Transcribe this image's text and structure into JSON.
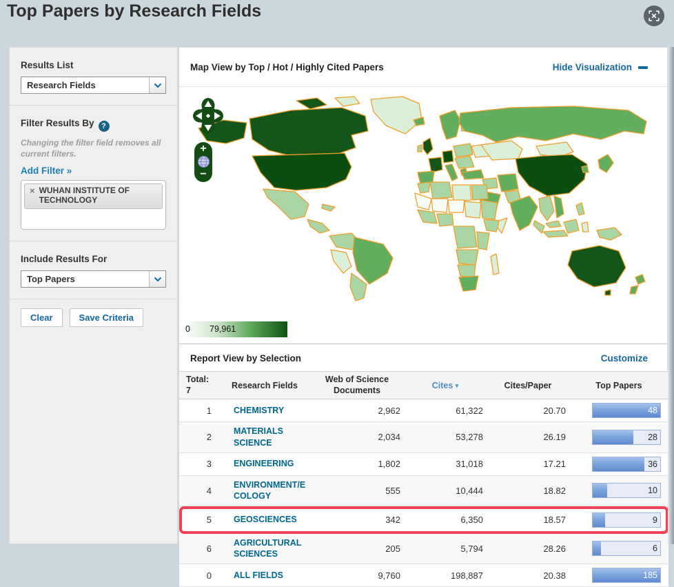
{
  "page": {
    "title": "Top Papers by Research Fields"
  },
  "colors": {
    "page_bg": "#ccd6dd",
    "link_blue": "#15679d",
    "field_link_blue": "#00688f",
    "sorted_column_blue": "#4d8fc0",
    "highlight_red": "#ee4257",
    "bar_fill_blue": "#7ea4de",
    "map_border_orange": "#efa02c",
    "map_dark_green": "#14551a",
    "control_green": "#134d13"
  },
  "sidebar": {
    "results_list_label": "Results List",
    "results_list_value": "Research Fields",
    "filter_label": "Filter Results By",
    "filter_help": "?",
    "filter_note": "Changing the filter field removes all current filters.",
    "add_filter": "Add Filter »",
    "tag_close": "×",
    "tag_label": "WUHAN INSTITUTE OF TECHNOLOGY",
    "include_label": "Include Results For",
    "include_value": "Top Papers",
    "clear_button": "Clear",
    "save_button": "Save Criteria"
  },
  "map_view": {
    "title": "Map View by Top / Hot / Highly Cited Papers",
    "hide_link": "Hide Visualization",
    "legend_min": "0",
    "legend_max": "79,961",
    "zoom_in": "+",
    "zoom_out": "−"
  },
  "report": {
    "title": "Report View by Selection",
    "customize_link": "Customize",
    "col_total": "Total:\n7",
    "col_field": "Research Fields",
    "col_docs": "Web of Science\nDocuments",
    "col_cites": "Cites",
    "sort_icon": "▾",
    "col_cpp": "Cites/Paper",
    "col_top": "Top Papers",
    "rows": [
      {
        "rank": "1",
        "field": "CHEMISTRY",
        "docs": "2,962",
        "cites": "61,322",
        "cpp": "20.70",
        "top_papers": "48",
        "bar_pct": 100,
        "bar_full": true,
        "highlight": false,
        "shaded": false
      },
      {
        "rank": "2",
        "field": "MATERIALS\nSCIENCE",
        "docs": "2,034",
        "cites": "53,278",
        "cpp": "26.19",
        "top_papers": "28",
        "bar_pct": 60,
        "bar_full": false,
        "highlight": false,
        "shaded": true
      },
      {
        "rank": "3",
        "field": "ENGINEERING",
        "docs": "1,802",
        "cites": "31,018",
        "cpp": "17.21",
        "top_papers": "36",
        "bar_pct": 77,
        "bar_full": false,
        "highlight": false,
        "shaded": false
      },
      {
        "rank": "4",
        "field": "ENVIRONMENT/E\nCOLOGY",
        "docs": "555",
        "cites": "10,444",
        "cpp": "18.82",
        "top_papers": "10",
        "bar_pct": 21,
        "bar_full": false,
        "highlight": false,
        "shaded": true
      },
      {
        "rank": "5",
        "field": "GEOSCIENCES",
        "docs": "342",
        "cites": "6,350",
        "cpp": "18.57",
        "top_papers": "9",
        "bar_pct": 18,
        "bar_full": false,
        "highlight": true,
        "shaded": false
      },
      {
        "rank": "6",
        "field": "AGRICULTURAL\nSCIENCES",
        "docs": "205",
        "cites": "5,794",
        "cpp": "28.26",
        "top_papers": "6",
        "bar_pct": 12,
        "bar_full": false,
        "highlight": false,
        "shaded": true
      },
      {
        "rank": "0",
        "field": "ALL FIELDS",
        "docs": "9,760",
        "cites": "198,887",
        "cpp": "20.38",
        "top_papers": "185",
        "bar_pct": 100,
        "bar_full": true,
        "highlight": false,
        "shaded": false
      }
    ]
  }
}
